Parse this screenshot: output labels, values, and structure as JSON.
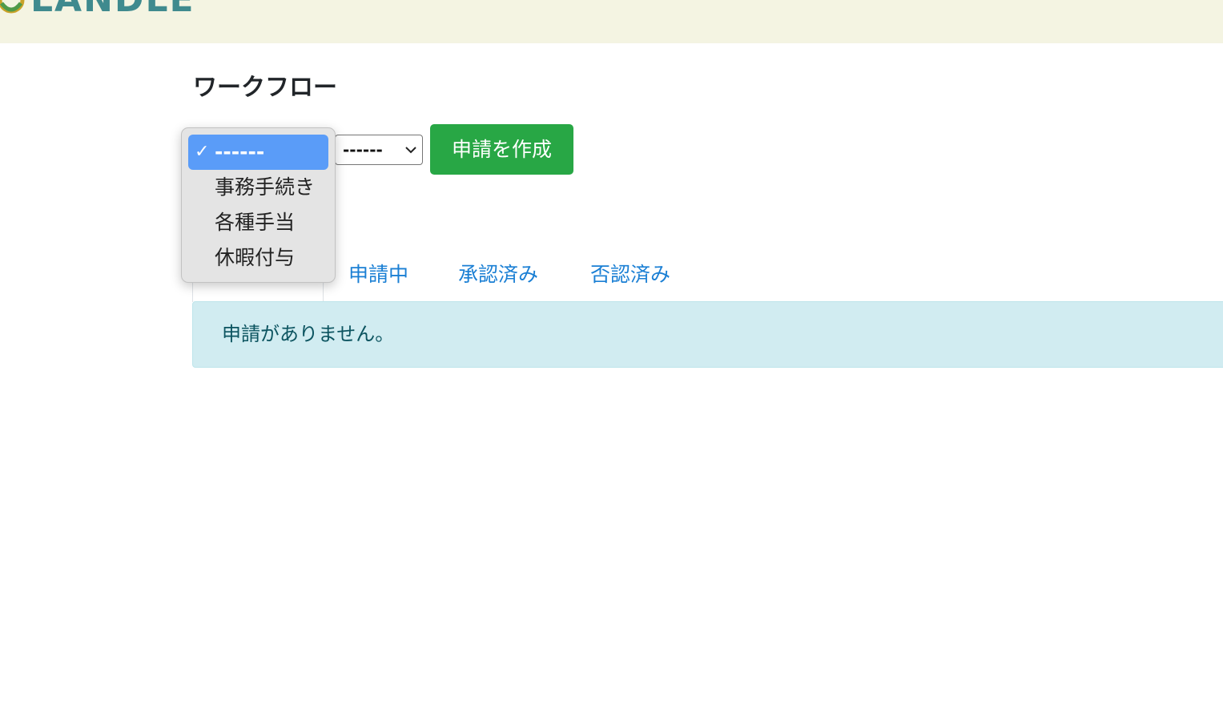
{
  "header": {
    "logo_text": "LANDLE",
    "background": "#f4f4e2"
  },
  "page": {
    "title": "ワークフロー"
  },
  "toolbar": {
    "category_select": {
      "selected": "------",
      "options": [
        "------",
        "事務手続き",
        "各種手当",
        "休暇付与"
      ],
      "open": true
    },
    "type_select": {
      "selected": "------"
    },
    "create_button_label": "申請を作成",
    "create_button_color": "#28a745"
  },
  "tabs": {
    "active_label": "",
    "items": [
      {
        "label": "申請中"
      },
      {
        "label": "承認済み"
      },
      {
        "label": "否認済み"
      }
    ],
    "link_color": "#1a7fd4"
  },
  "alert": {
    "message": "申請がありません。",
    "background": "#d1ecf1"
  }
}
